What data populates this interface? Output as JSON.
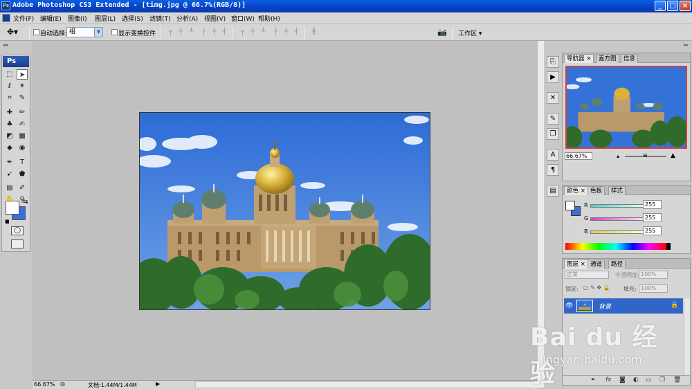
{
  "window": {
    "title": "Adobe Photoshop CS3 Extended - [timg.jpg @ 66.7%(RGB/8)]",
    "app_badge": "Ps",
    "minimize": "_",
    "maximize": "□",
    "close": "×"
  },
  "menu": [
    "文件(F)",
    "编辑(E)",
    "图像(I)",
    "图层(L)",
    "选择(S)",
    "滤镜(T)",
    "分析(A)",
    "视图(V)",
    "窗口(W)",
    "帮助(H)"
  ],
  "options_bar": {
    "auto_select_label": "自动选择:",
    "auto_select_value": "组",
    "show_transform_label": "显示变换控件",
    "workspace_label": "工作区"
  },
  "toolbox": {
    "badge": "Ps",
    "foreground_color": "#ffffff",
    "background_color": "#3b6fd8"
  },
  "document": {
    "filename": "timg.jpg",
    "zoom": "66.7%",
    "mode": "RGB/8"
  },
  "status_bar": {
    "zoom": "66.67%",
    "doc_info": "文档:1.44M/1.44M"
  },
  "navigator_panel": {
    "tabs": [
      "导航器",
      "直方图",
      "信息"
    ],
    "active_tab": 0,
    "zoom": "66.67%"
  },
  "color_panel": {
    "tabs": [
      "颜色",
      "色板",
      "样式"
    ],
    "active_tab": 0,
    "channels": [
      {
        "label": "R",
        "value": "255",
        "color": "#3fd6c4"
      },
      {
        "label": "G",
        "value": "255",
        "color": "#d642c8"
      },
      {
        "label": "B",
        "value": "255",
        "color": "#d6d642"
      }
    ]
  },
  "layers_panel": {
    "tabs": [
      "图层",
      "通道",
      "路径"
    ],
    "active_tab": 0,
    "blend_mode": "正常",
    "opacity_label": "不透明度:",
    "opacity_value": "100%",
    "lock_label": "锁定:",
    "fill_label": "填充:",
    "fill_value": "100%",
    "layers": [
      {
        "name": "背景",
        "visible": true,
        "locked": true,
        "selected": true
      }
    ]
  },
  "watermark": {
    "main": "Bai du 经验",
    "sub": "jingyan.baidu.com"
  }
}
